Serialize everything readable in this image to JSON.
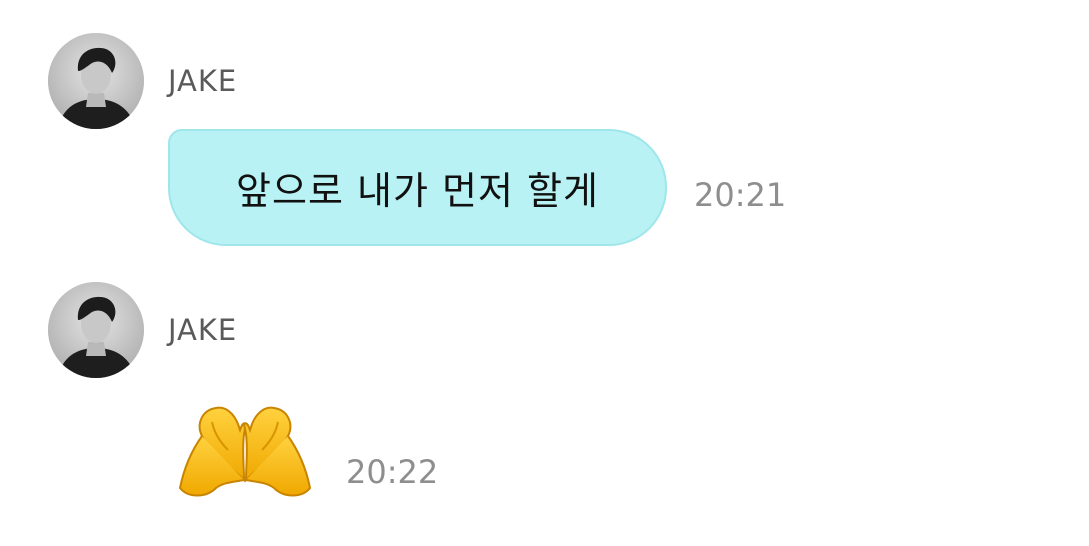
{
  "messages": [
    {
      "sender": "JAKE",
      "text": "앞으로 내가 먼저 할게",
      "time": "20:21"
    },
    {
      "sender": "JAKE",
      "emoji": "heart-hands-emoji",
      "time": "20:22"
    }
  ],
  "colors": {
    "bubble_bg": "#b9f2f4",
    "bubble_border": "#9fe6ea",
    "name_text": "#5a5a5a",
    "time_text": "#8e8e8e"
  }
}
